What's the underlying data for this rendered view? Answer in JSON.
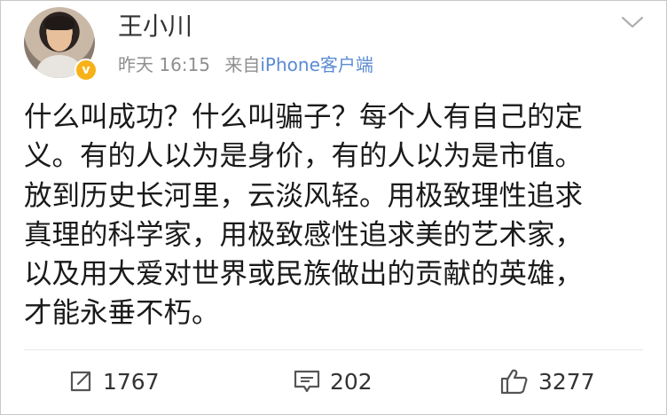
{
  "post": {
    "author": {
      "name": "王小川",
      "verified": true
    },
    "time": "昨天 16:15",
    "source_prefix": "来自",
    "source": "iPhone客户端",
    "lines": [
      "什么叫成功？什么叫骗子？每个人有自己的定",
      "义。有的人以为是身价，有的人以为是市值。",
      "放到历史长河里，云淡风轻。用极致理性追求",
      "真理的科学家，用极致感性追求美的艺术家，",
      "以及用大爱对世界或民族做出的贡献的英雄，",
      "才能永垂不朽。"
    ]
  },
  "actions": {
    "repost": {
      "icon": "share-icon",
      "count": "1767"
    },
    "comment": {
      "icon": "comment-icon",
      "count": "202"
    },
    "like": {
      "icon": "thumbs-up-icon",
      "count": "3277"
    }
  },
  "colors": {
    "text": "#1a1a1a",
    "meta": "#8f8f8f",
    "link": "#5b8bd4",
    "verified_badge": "#f7b21a"
  }
}
